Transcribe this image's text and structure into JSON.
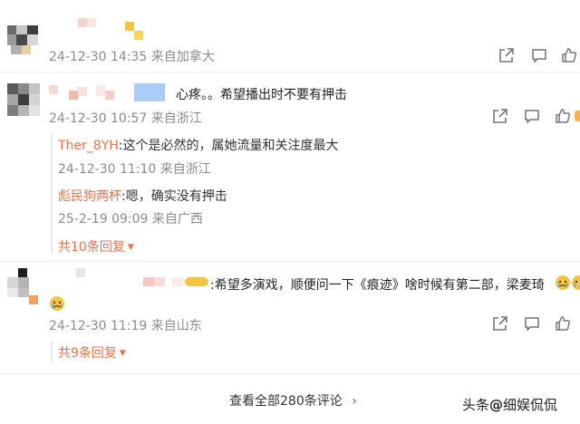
{
  "comments": [
    {
      "text": "",
      "meta": "24-12-30 14:35 来自加拿大"
    },
    {
      "text": "心疼。。希望播出时不要有押击",
      "meta": "24-12-30 10:57 来自浙江",
      "replies": [
        {
          "name": "Ther_8YH",
          "text": ":这个是必然的，属她流量和关注度最大",
          "meta": "24-12-30 11:10 来自浙江"
        },
        {
          "name": "彪民狗两杯",
          "text": ":嗯，确实没有押击",
          "meta": "25-2-19 09:09 来自广西"
        }
      ],
      "expand_label": "共10条回复"
    },
    {
      "text": ":希望多演戏，顺便问一下《痕迹》啥时候有第二部，梁麦琦",
      "meta": "24-12-30 11:19 来自山东",
      "expand_label": "共9条回复"
    }
  ],
  "view_all_label": "查看全部280条评论",
  "view_all_chevron": "›",
  "expand_caret": "▼",
  "watermark": {
    "prefix": "头条",
    "at": "@",
    "name": "细娱侃侃"
  },
  "icons": [
    "share-icon",
    "comment-icon",
    "like-icon"
  ],
  "colors": {
    "link": "#eb7350",
    "meta": "#8c8c8c",
    "text": "#1f1f1f",
    "blur_blue": "#a9cdf5",
    "blur_yellow": "#f5c542"
  }
}
